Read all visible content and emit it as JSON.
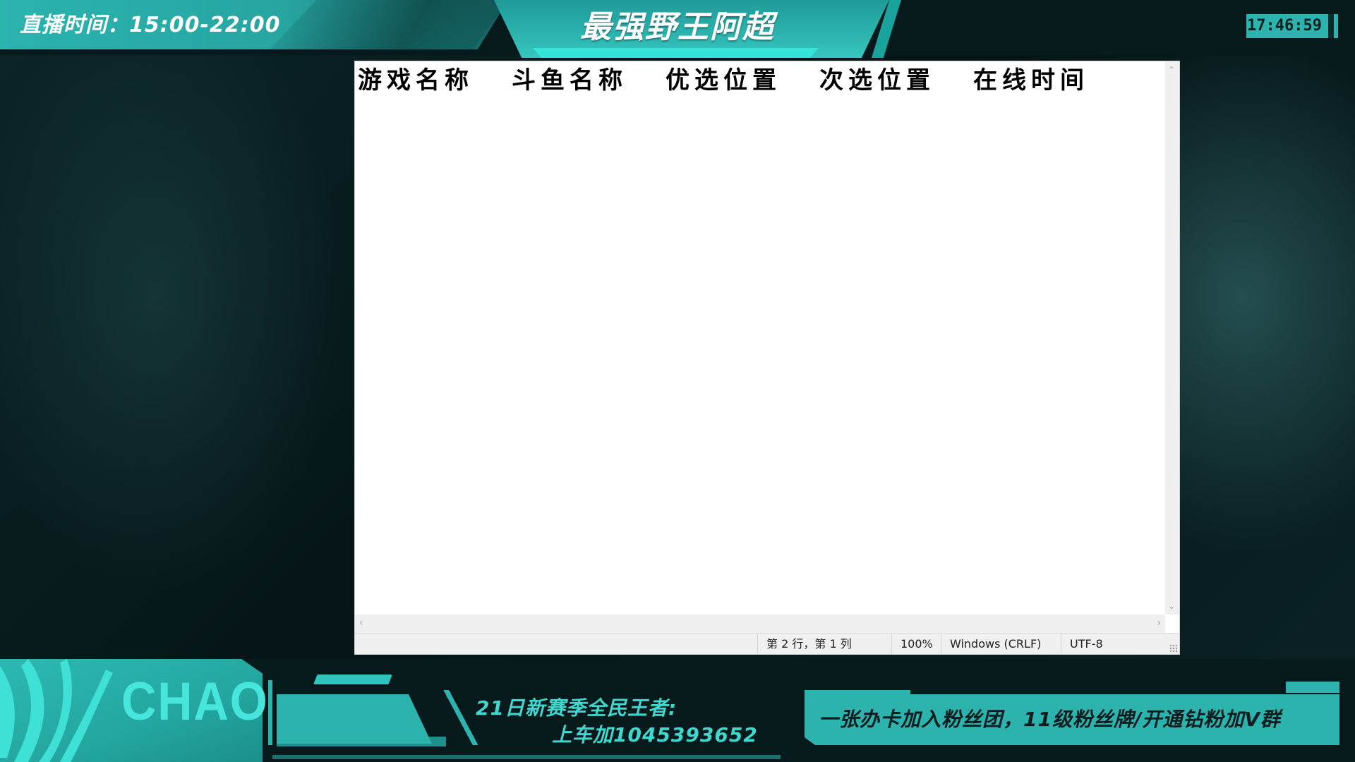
{
  "overlay": {
    "schedule_label": "直播时间：15:00-22:00",
    "stream_title": "最强野王阿超",
    "clock": "17:46:59",
    "brand_text": "CHAO",
    "promo_line1": "21日新赛季全民王者:",
    "promo_line2": "上车加1045393652",
    "fan_club_text": "一张办卡加入粉丝团，11级粉丝牌/开通钻粉加V群"
  },
  "notepad": {
    "header_columns": [
      "游戏名称",
      "斗鱼名称",
      "优选位置",
      "次选位置",
      "在线时间"
    ],
    "status": {
      "cursor_position": "第 2 行，第 1 列",
      "zoom": "100%",
      "line_ending": "Windows (CRLF)",
      "encoding": "UTF-8"
    }
  },
  "colors": {
    "accent": "#2cb3ad",
    "accent_bright": "#35e3d9",
    "background_dark": "#061617"
  }
}
